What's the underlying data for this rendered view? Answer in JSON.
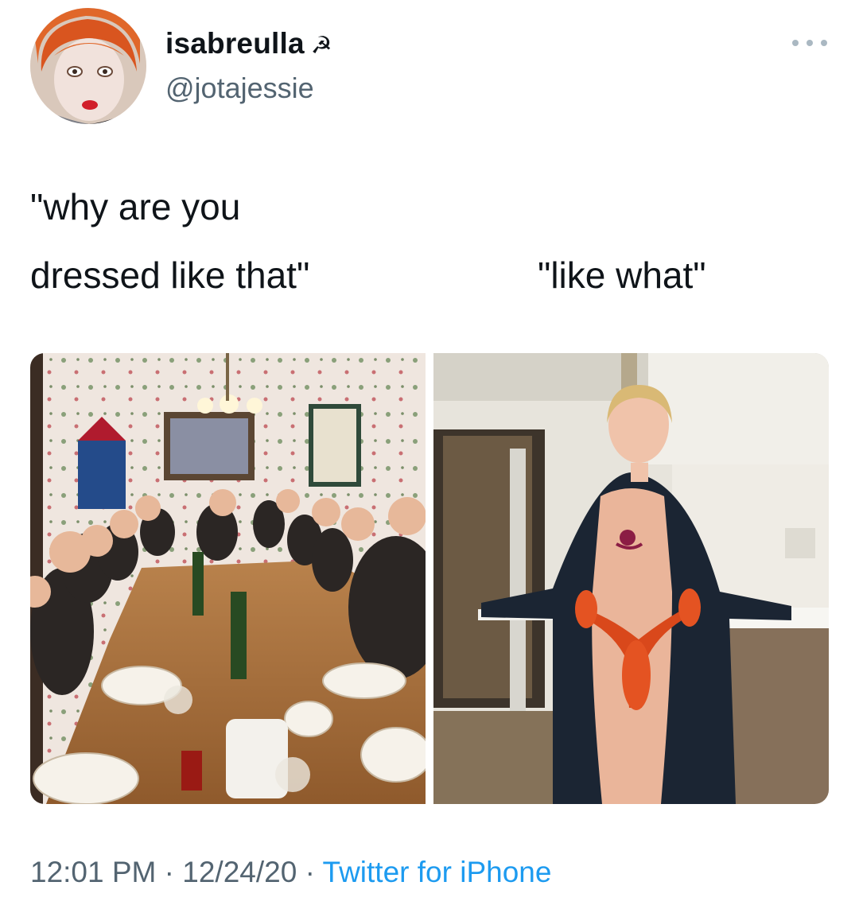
{
  "author": {
    "display_name": "isabreulla",
    "emoji": "☭",
    "handle": "@jotajessie"
  },
  "tweet": {
    "lines": [
      "\"why are you",
      "dressed like that\"",
      "\"like what\""
    ]
  },
  "footer": {
    "time": "12:01 PM",
    "separator": "·",
    "date": "12/24/20",
    "source": "Twitter for iPhone"
  },
  "colors": {
    "text_primary": "#0f1419",
    "text_secondary": "#536471",
    "link": "#1d9bf0"
  },
  "icons": {
    "more": "more-horizontal-icon"
  }
}
